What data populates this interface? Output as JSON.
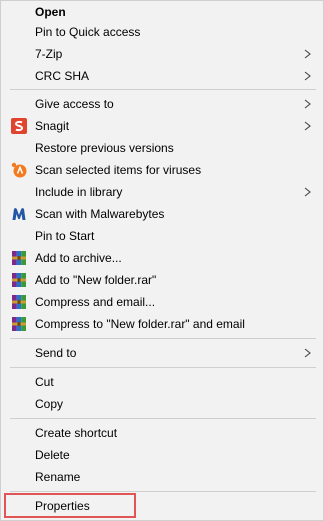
{
  "menu": {
    "items": [
      {
        "label": "Open",
        "bold": true
      },
      {
        "label": "Pin to Quick access"
      },
      {
        "label": "7-Zip",
        "submenu": true
      },
      {
        "label": "CRC SHA",
        "submenu": true
      },
      {
        "label": "Give access to",
        "submenu": true
      },
      {
        "label": "Snagit",
        "icon": "snagit-icon",
        "submenu": true
      },
      {
        "label": "Restore previous versions"
      },
      {
        "label": "Scan selected items for viruses",
        "icon": "avast-icon"
      },
      {
        "label": "Include in library",
        "submenu": true
      },
      {
        "label": "Scan with Malwarebytes",
        "icon": "malwarebytes-icon"
      },
      {
        "label": "Pin to Start"
      },
      {
        "label": "Add to archive...",
        "icon": "winrar-icon"
      },
      {
        "label": "Add to \"New folder.rar\"",
        "icon": "winrar-icon"
      },
      {
        "label": "Compress and email...",
        "icon": "winrar-icon"
      },
      {
        "label": "Compress to \"New folder.rar\" and email",
        "icon": "winrar-icon"
      },
      {
        "label": "Send to",
        "submenu": true
      },
      {
        "label": "Cut"
      },
      {
        "label": "Copy"
      },
      {
        "label": "Create shortcut"
      },
      {
        "label": "Delete"
      },
      {
        "label": "Rename"
      },
      {
        "label": "Properties",
        "highlighted": true
      }
    ]
  },
  "colors": {
    "menu_background": "#f2f2f2",
    "separator": "#cfcfcf",
    "highlight_border": "#e05555",
    "snagit": "#e0442e",
    "avast": "#f47a20",
    "malwarebytes": "#2456a6"
  }
}
